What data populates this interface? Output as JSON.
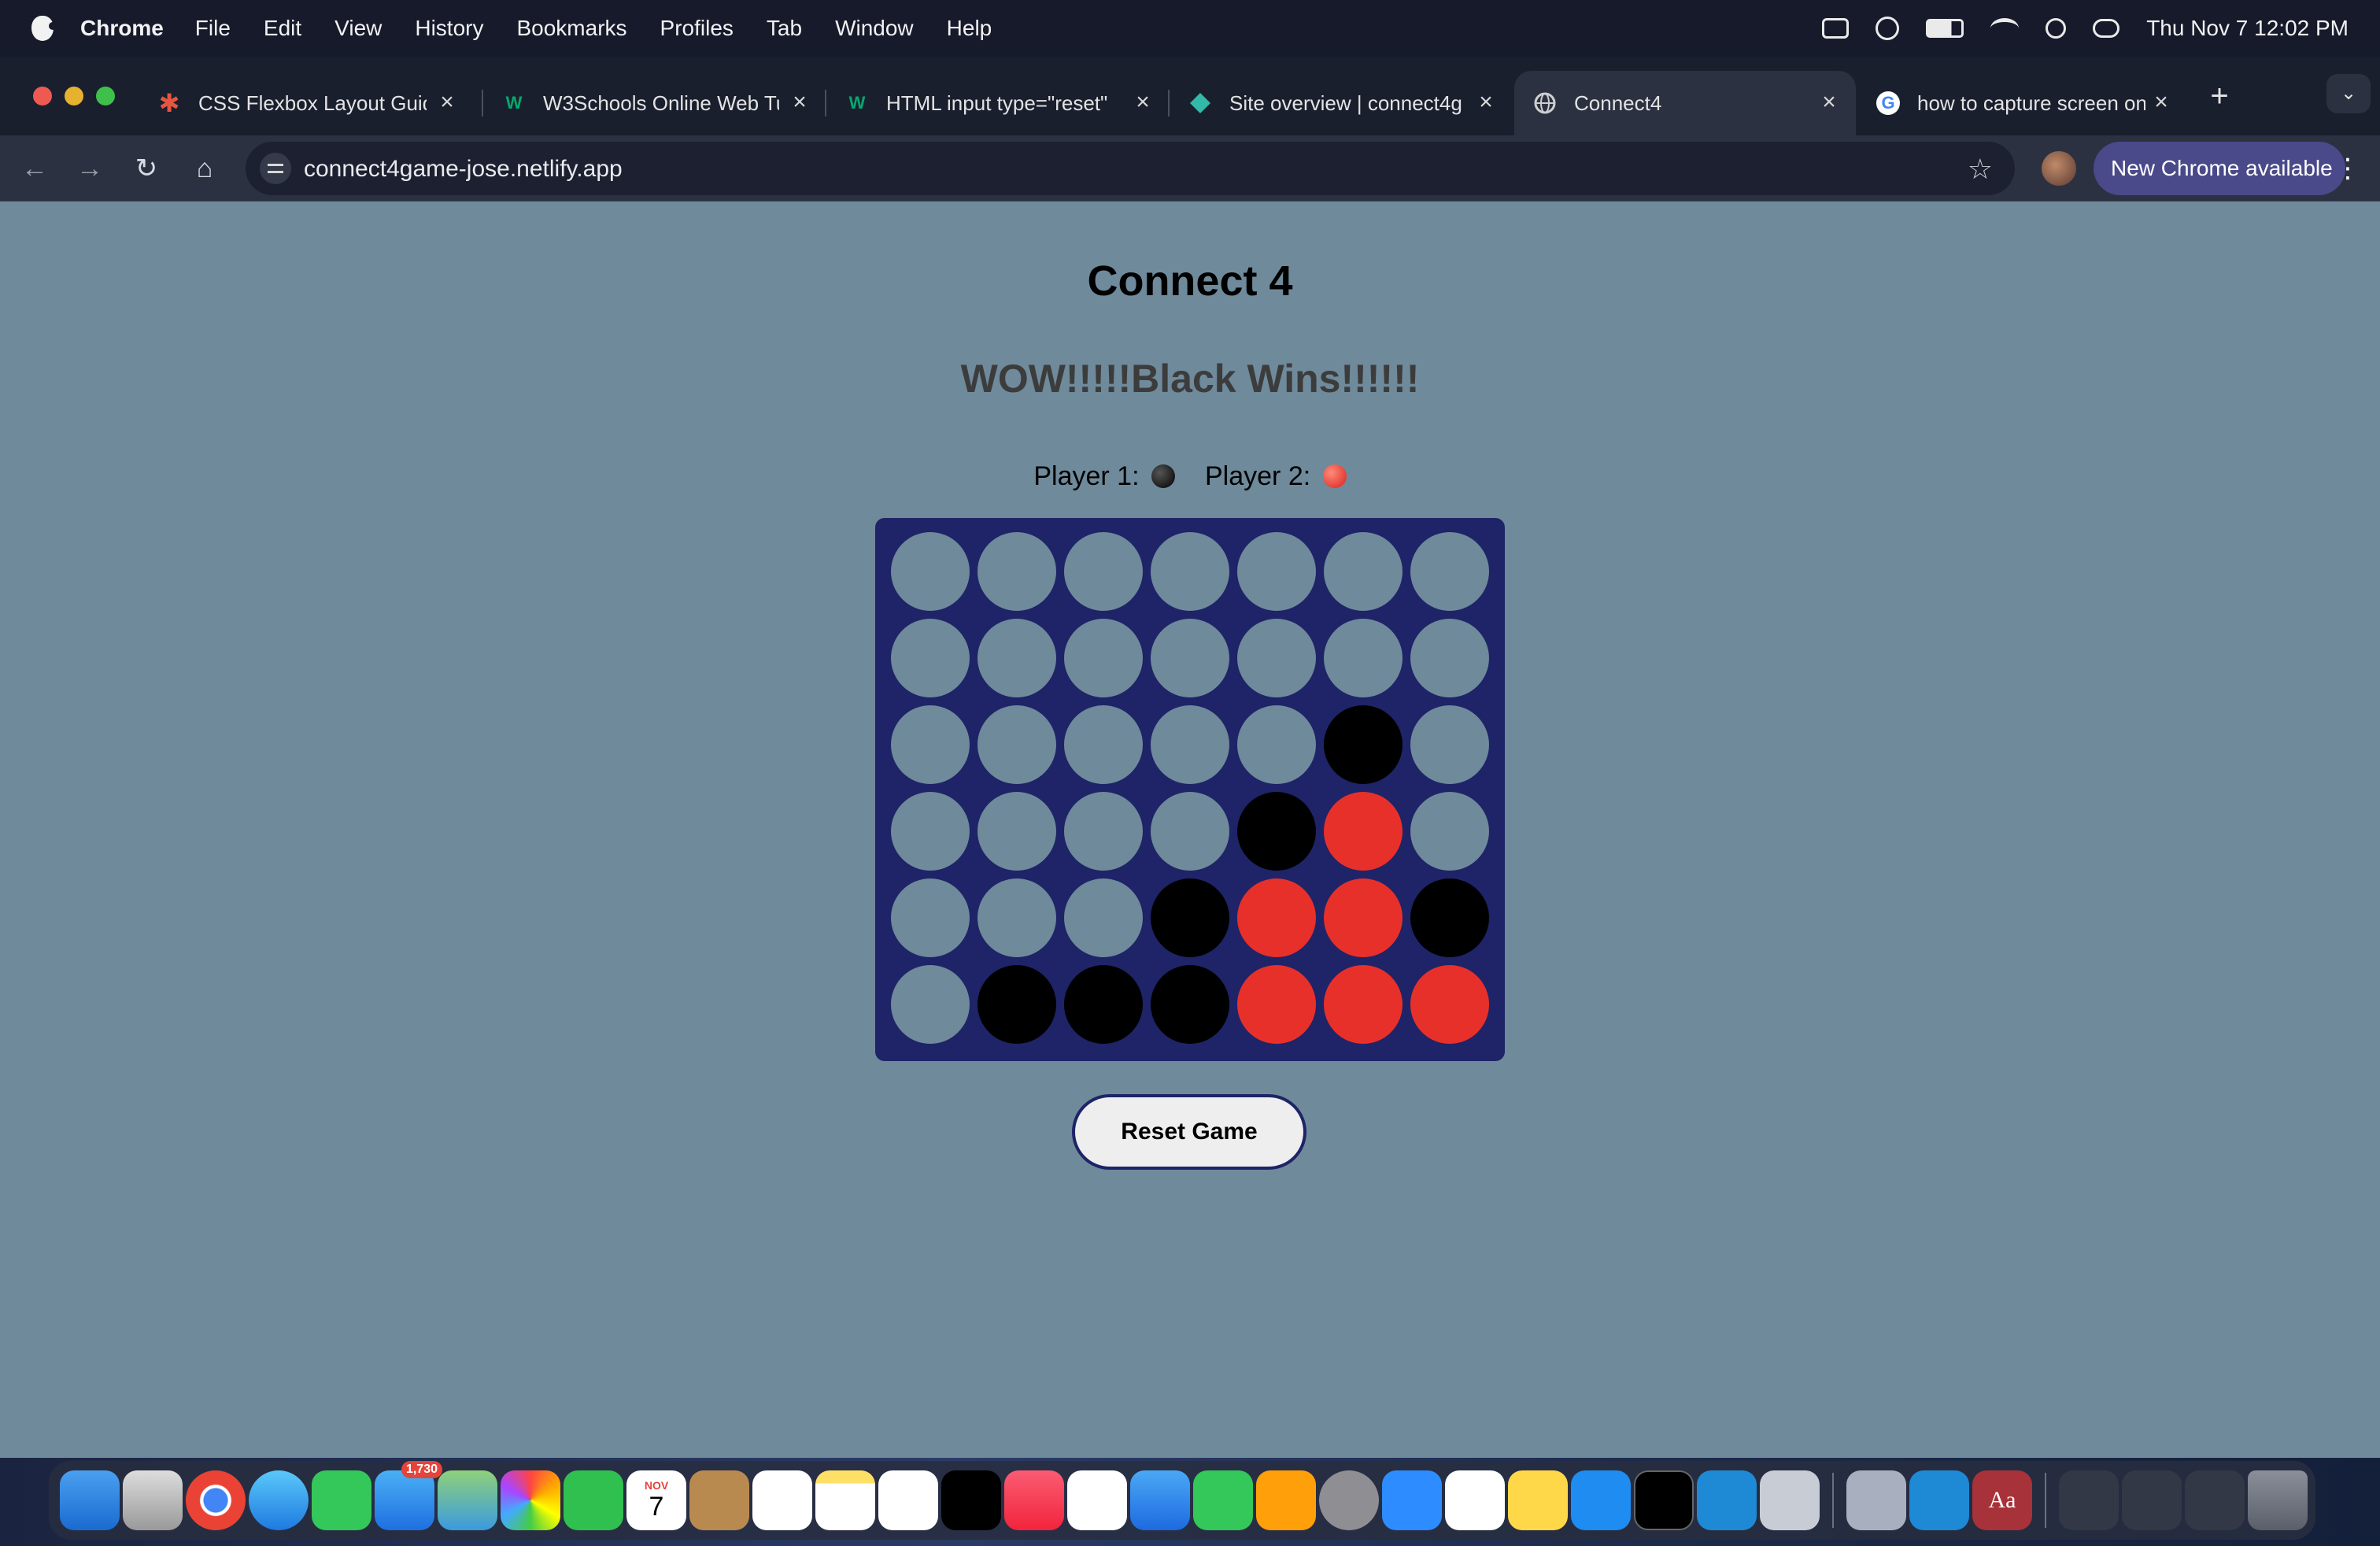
{
  "menubar": {
    "app_name": "Chrome",
    "items": [
      "File",
      "Edit",
      "View",
      "History",
      "Bookmarks",
      "Profiles",
      "Tab",
      "Window",
      "Help"
    ],
    "clock": "Thu Nov 7  12:02 PM"
  },
  "tabs": [
    {
      "title": "CSS Flexbox Layout Guide",
      "favicon": "asterisk-icon"
    },
    {
      "title": "W3Schools Online Web Tu",
      "favicon": "w3schools-icon"
    },
    {
      "title": "HTML input type=\"reset\"",
      "favicon": "w3schools-icon"
    },
    {
      "title": "Site overview | connect4g",
      "favicon": "netlify-icon"
    },
    {
      "title": "Connect4",
      "favicon": "globe-icon"
    },
    {
      "title": "how to capture screen on",
      "favicon": "google-icon"
    }
  ],
  "toolbar": {
    "url": "connect4game-jose.netlify.app",
    "update_label": "New Chrome available"
  },
  "game": {
    "title": "Connect 4",
    "message": "WOW!!!!!Black Wins!!!!!!",
    "player1_label": "Player 1:",
    "player2_label": "Player 2:",
    "reset_label": "Reset Game",
    "colors": {
      "empty": "#6f8a9b",
      "black": "#000000",
      "red": "#e8302a",
      "board": "#1e2467"
    },
    "board": [
      [
        "empty",
        "empty",
        "empty",
        "empty",
        "empty",
        "empty",
        "empty"
      ],
      [
        "empty",
        "empty",
        "empty",
        "empty",
        "empty",
        "empty",
        "empty"
      ],
      [
        "empty",
        "empty",
        "empty",
        "empty",
        "empty",
        "black",
        "empty"
      ],
      [
        "empty",
        "empty",
        "empty",
        "empty",
        "black",
        "red",
        "empty"
      ],
      [
        "empty",
        "empty",
        "empty",
        "black",
        "red",
        "red",
        "black"
      ],
      [
        "empty",
        "black",
        "black",
        "black",
        "red",
        "red",
        "red"
      ]
    ]
  },
  "dock": {
    "mail_badge": "1,730",
    "calendar_month": "NOV",
    "calendar_day": "7"
  }
}
